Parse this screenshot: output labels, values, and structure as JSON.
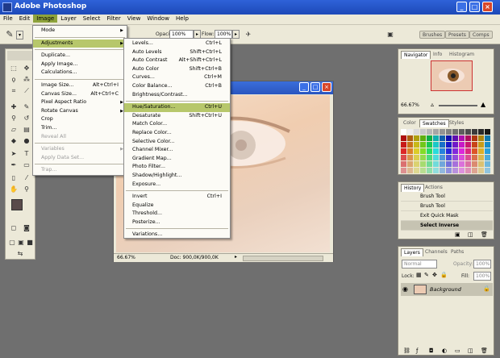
{
  "app": {
    "title": "Adobe Photoshop"
  },
  "menubar": {
    "items": [
      "File",
      "Edit",
      "Image",
      "Layer",
      "Select",
      "Filter",
      "View",
      "Window",
      "Help"
    ],
    "active": "Image"
  },
  "options": {
    "opacity_label": "Opacity:",
    "opacity_value": "100%",
    "flow_label": "Flow:",
    "flow_value": "100%"
  },
  "well_tabs": [
    "Brushes",
    "Presets",
    "Comps"
  ],
  "image_menu": {
    "items": [
      {
        "label": "Mode",
        "shortcut": "",
        "submenu": true,
        "disabled": false
      },
      {
        "sep": true
      },
      {
        "label": "Adjustments",
        "shortcut": "",
        "submenu": true,
        "disabled": false,
        "highlight": true
      },
      {
        "sep": true
      },
      {
        "label": "Duplicate...",
        "shortcut": "",
        "submenu": false,
        "disabled": false
      },
      {
        "label": "Apply Image...",
        "shortcut": "",
        "submenu": false,
        "disabled": false
      },
      {
        "label": "Calculations...",
        "shortcut": "",
        "submenu": false,
        "disabled": false
      },
      {
        "sep": true
      },
      {
        "label": "Image Size...",
        "shortcut": "Alt+Ctrl+I",
        "submenu": false,
        "disabled": false
      },
      {
        "label": "Canvas Size...",
        "shortcut": "Alt+Ctrl+C",
        "submenu": false,
        "disabled": false
      },
      {
        "label": "Pixel Aspect Ratio",
        "shortcut": "",
        "submenu": true,
        "disabled": false
      },
      {
        "label": "Rotate Canvas",
        "shortcut": "",
        "submenu": true,
        "disabled": false
      },
      {
        "label": "Crop",
        "shortcut": "",
        "submenu": false,
        "disabled": false
      },
      {
        "label": "Trim...",
        "shortcut": "",
        "submenu": false,
        "disabled": false
      },
      {
        "label": "Reveal All",
        "shortcut": "",
        "submenu": false,
        "disabled": true
      },
      {
        "sep": true
      },
      {
        "label": "Variables",
        "shortcut": "",
        "submenu": true,
        "disabled": true
      },
      {
        "label": "Apply Data Set...",
        "shortcut": "",
        "submenu": false,
        "disabled": true
      },
      {
        "sep": true
      },
      {
        "label": "Trap...",
        "shortcut": "",
        "submenu": false,
        "disabled": true
      }
    ]
  },
  "adjust_menu": {
    "items": [
      {
        "label": "Levels...",
        "shortcut": "Ctrl+L"
      },
      {
        "label": "Auto Levels",
        "shortcut": "Shift+Ctrl+L"
      },
      {
        "label": "Auto Contrast",
        "shortcut": "Alt+Shift+Ctrl+L"
      },
      {
        "label": "Auto Color",
        "shortcut": "Shift+Ctrl+B"
      },
      {
        "label": "Curves...",
        "shortcut": "Ctrl+M"
      },
      {
        "label": "Color Balance...",
        "shortcut": "Ctrl+B"
      },
      {
        "label": "Brightness/Contrast...",
        "shortcut": ""
      },
      {
        "sep": true
      },
      {
        "label": "Hue/Saturation...",
        "shortcut": "Ctrl+U",
        "highlight": true
      },
      {
        "label": "Desaturate",
        "shortcut": "Shift+Ctrl+U"
      },
      {
        "label": "Match Color...",
        "shortcut": ""
      },
      {
        "label": "Replace Color...",
        "shortcut": ""
      },
      {
        "label": "Selective Color...",
        "shortcut": ""
      },
      {
        "label": "Channel Mixer...",
        "shortcut": ""
      },
      {
        "label": "Gradient Map...",
        "shortcut": ""
      },
      {
        "label": "Photo Filter...",
        "shortcut": ""
      },
      {
        "label": "Shadow/Highlight...",
        "shortcut": ""
      },
      {
        "label": "Exposure...",
        "shortcut": ""
      },
      {
        "sep": true
      },
      {
        "label": "Invert",
        "shortcut": "Ctrl+I"
      },
      {
        "label": "Equalize",
        "shortcut": ""
      },
      {
        "label": "Threshold...",
        "shortcut": ""
      },
      {
        "label": "Posterize...",
        "shortcut": ""
      },
      {
        "sep": true
      },
      {
        "label": "Variations...",
        "shortcut": ""
      }
    ]
  },
  "document": {
    "zoom": "66.67%",
    "doc_info": "Doc: 900,0K/900,0K"
  },
  "navigator": {
    "tabs": [
      "Navigator",
      "Info",
      "Histogram"
    ],
    "zoom": "66.67%"
  },
  "swatches": {
    "tabs": [
      "Color",
      "Swatches",
      "Styles"
    ]
  },
  "history": {
    "tabs": [
      "History",
      "Actions"
    ],
    "items": [
      "Brush Tool",
      "Brush Tool",
      "Exit Quick Mask",
      "Select Inverse"
    ]
  },
  "layers": {
    "tabs": [
      "Layers",
      "Channels",
      "Paths"
    ],
    "blend_mode": "Normal",
    "opacity_label": "Opacity:",
    "opacity_value": "100%",
    "lock_label": "Lock:",
    "fill_label": "Fill:",
    "fill_value": "100%",
    "layer_name": "Background"
  },
  "colors": {
    "menu_highlight": "#b7c76b",
    "titlebar": "#2a58c9",
    "workspace": "#6f6f6f",
    "foreground_swatch": "#5a4b4b",
    "background_swatch": "#ffffff"
  }
}
